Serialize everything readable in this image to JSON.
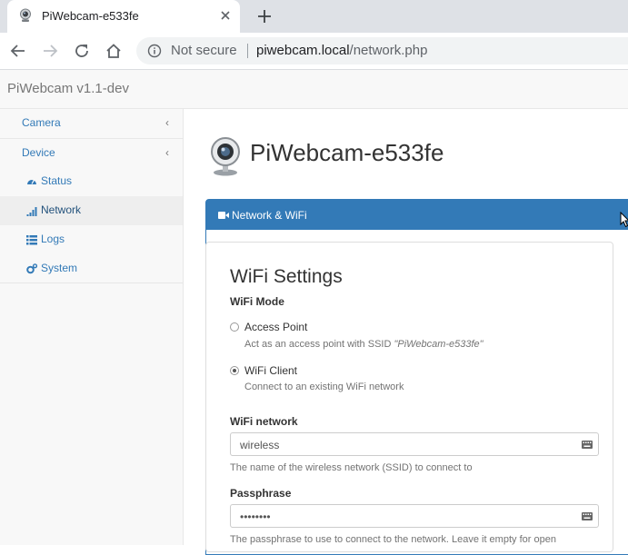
{
  "browser": {
    "tab_title": "PiWebcam-e533fe",
    "not_secure": "Not secure",
    "url_host": "piwebcam.local",
    "url_path": "/network.php"
  },
  "app": {
    "brand": "PiWebcam v1.1-dev",
    "page_title": "PiWebcam-e533fe"
  },
  "sidebar": {
    "items": [
      {
        "label": "Camera",
        "icon": "chevron-left-icon"
      },
      {
        "label": "Device",
        "icon": "chevron-left-icon"
      }
    ],
    "sub_items": [
      {
        "label": "Status",
        "icon": "dashboard-icon"
      },
      {
        "label": "Network",
        "icon": "signal-icon",
        "active": true
      },
      {
        "label": "Logs",
        "icon": "list-icon"
      },
      {
        "label": "System",
        "icon": "cogs-icon"
      }
    ]
  },
  "panel": {
    "title": "Network & WiFi",
    "icon": "video-camera-icon"
  },
  "form": {
    "heading": "WiFi Settings",
    "mode_label": "WiFi Mode",
    "modes": [
      {
        "label": "Access Point",
        "help_prefix": "Act as an access point with SSID ",
        "help_ssid": "\"PiWebcam-e533fe\"",
        "selected": false
      },
      {
        "label": "WiFi Client",
        "help_prefix": "Connect to an existing WiFi network",
        "help_ssid": "",
        "selected": true
      }
    ],
    "network": {
      "label": "WiFi network",
      "value": "wireless",
      "help": "The name of the wireless network (SSID) to connect to"
    },
    "passphrase": {
      "label": "Passphrase",
      "value": "••••••••",
      "help": "The passphrase to use to connect to the network. Leave it empty for open"
    }
  },
  "colors": {
    "primary": "#337ab7",
    "link": "#337ab7",
    "navbar_bg": "#f8f8f8"
  }
}
